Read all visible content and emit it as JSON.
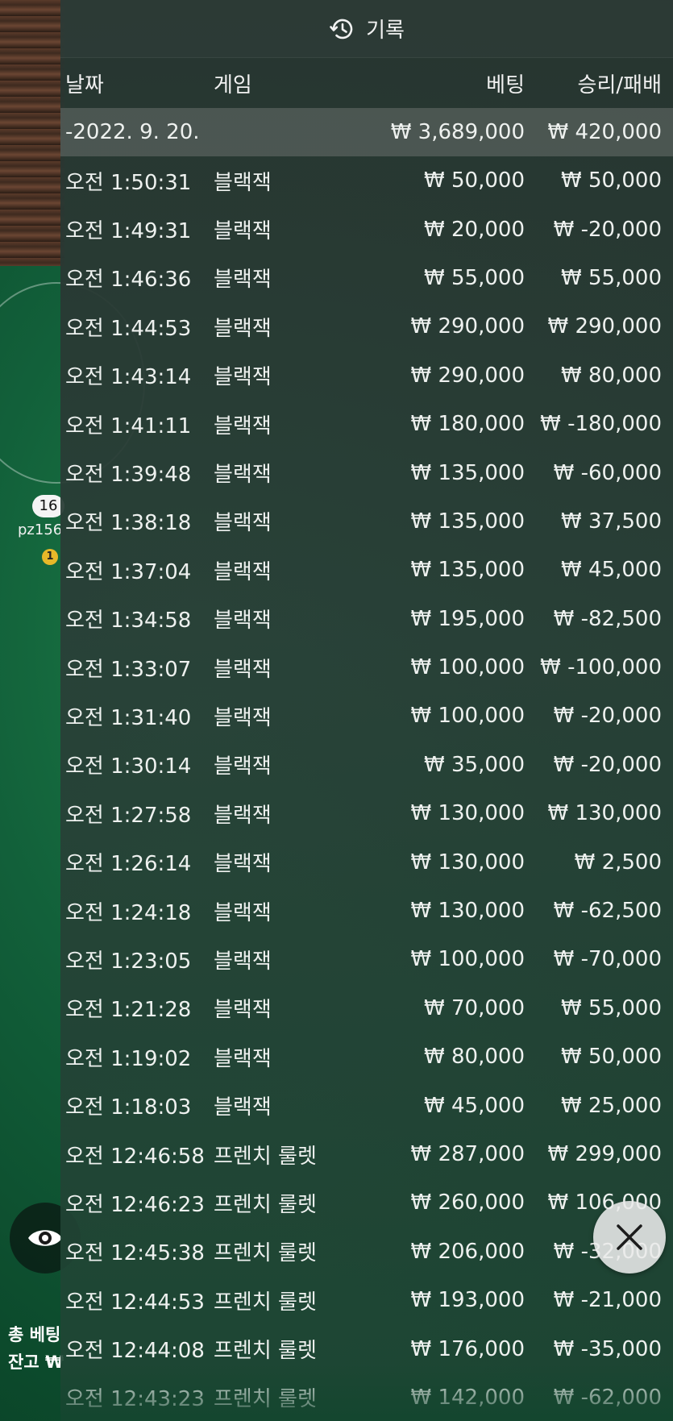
{
  "panel": {
    "title": "기록"
  },
  "columns": {
    "date": "날짜",
    "game": "게임",
    "bet": "베팅",
    "result": "승리/패배"
  },
  "date_group": {
    "label": "-2022. 9. 20.",
    "bet_total": "₩ 3,689,000",
    "result_total": "₩ 420,000"
  },
  "rows": [
    {
      "time": "오전 1:50:31",
      "game": "블랙잭",
      "bet": "₩ 50,000",
      "result": "₩ 50,000"
    },
    {
      "time": "오전 1:49:31",
      "game": "블랙잭",
      "bet": "₩ 20,000",
      "result": "₩ -20,000"
    },
    {
      "time": "오전 1:46:36",
      "game": "블랙잭",
      "bet": "₩ 55,000",
      "result": "₩ 55,000"
    },
    {
      "time": "오전 1:44:53",
      "game": "블랙잭",
      "bet": "₩ 290,000",
      "result": "₩ 290,000"
    },
    {
      "time": "오전 1:43:14",
      "game": "블랙잭",
      "bet": "₩ 290,000",
      "result": "₩ 80,000"
    },
    {
      "time": "오전 1:41:11",
      "game": "블랙잭",
      "bet": "₩ 180,000",
      "result": "₩ -180,000"
    },
    {
      "time": "오전 1:39:48",
      "game": "블랙잭",
      "bet": "₩ 135,000",
      "result": "₩ -60,000"
    },
    {
      "time": "오전 1:38:18",
      "game": "블랙잭",
      "bet": "₩ 135,000",
      "result": "₩ 37,500"
    },
    {
      "time": "오전 1:37:04",
      "game": "블랙잭",
      "bet": "₩ 135,000",
      "result": "₩ 45,000"
    },
    {
      "time": "오전 1:34:58",
      "game": "블랙잭",
      "bet": "₩ 195,000",
      "result": "₩ -82,500"
    },
    {
      "time": "오전 1:33:07",
      "game": "블랙잭",
      "bet": "₩ 100,000",
      "result": "₩ -100,000"
    },
    {
      "time": "오전 1:31:40",
      "game": "블랙잭",
      "bet": "₩ 100,000",
      "result": "₩ -20,000"
    },
    {
      "time": "오전 1:30:14",
      "game": "블랙잭",
      "bet": "₩ 35,000",
      "result": "₩ -20,000"
    },
    {
      "time": "오전 1:27:58",
      "game": "블랙잭",
      "bet": "₩ 130,000",
      "result": "₩ 130,000"
    },
    {
      "time": "오전 1:26:14",
      "game": "블랙잭",
      "bet": "₩ 130,000",
      "result": "₩ 2,500"
    },
    {
      "time": "오전 1:24:18",
      "game": "블랙잭",
      "bet": "₩ 130,000",
      "result": "₩ -62,500"
    },
    {
      "time": "오전 1:23:05",
      "game": "블랙잭",
      "bet": "₩ 100,000",
      "result": "₩ -70,000"
    },
    {
      "time": "오전 1:21:28",
      "game": "블랙잭",
      "bet": "₩ 70,000",
      "result": "₩ 55,000"
    },
    {
      "time": "오전 1:19:02",
      "game": "블랙잭",
      "bet": "₩ 80,000",
      "result": "₩ 50,000"
    },
    {
      "time": "오전 1:18:03",
      "game": "블랙잭",
      "bet": "₩ 45,000",
      "result": "₩ 25,000"
    },
    {
      "time": "오전 12:46:58",
      "game": "프렌치 룰렛",
      "bet": "₩ 287,000",
      "result": "₩ 299,000"
    },
    {
      "time": "오전 12:46:23",
      "game": "프렌치 룰렛",
      "bet": "₩ 260,000",
      "result": "₩ 106,000"
    },
    {
      "time": "오전 12:45:38",
      "game": "프렌치 룰렛",
      "bet": "₩ 206,000",
      "result": "₩ -32,000"
    },
    {
      "time": "오전 12:44:53",
      "game": "프렌치 룰렛",
      "bet": "₩ 193,000",
      "result": "₩ -21,000"
    },
    {
      "time": "오전 12:44:08",
      "game": "프렌치 룰렛",
      "bet": "₩ 176,000",
      "result": "₩ -35,000"
    },
    {
      "time": "오전 12:43:23",
      "game": "프렌치 룰렛",
      "bet": "₩ 142,000",
      "result": "₩ -62,000"
    }
  ],
  "background": {
    "player_badge": "16",
    "player_name": "pz156",
    "chip_label": "1",
    "total_bet_label": "총 베팅",
    "balance_label": "잔고 ₩"
  },
  "icons": {
    "history": "history-clock-icon",
    "close": "close-icon",
    "eye": "eye-icon"
  }
}
